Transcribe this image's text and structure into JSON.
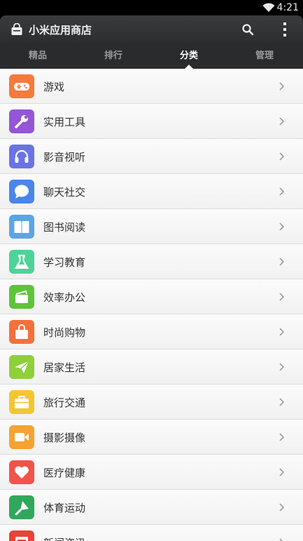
{
  "status_bar": {
    "time": "4:21",
    "wifi_icon": "wifi-icon"
  },
  "app_bar": {
    "title": "小米应用商店",
    "logo_icon": "shopping-bag-icon",
    "search_icon": "search-icon",
    "menu_icon": "more-vertical-icon"
  },
  "tabs": [
    {
      "label": "精品",
      "active": false
    },
    {
      "label": "排行",
      "active": false
    },
    {
      "label": "分类",
      "active": true
    },
    {
      "label": "管理",
      "active": false
    }
  ],
  "categories": [
    {
      "label": "游戏",
      "icon": "gamepad-icon",
      "color": "#f57a3c"
    },
    {
      "label": "实用工具",
      "icon": "wrench-icon",
      "color": "#9456d6"
    },
    {
      "label": "影音视听",
      "icon": "headphones-icon",
      "color": "#6a73e6"
    },
    {
      "label": "聊天社交",
      "icon": "chat-bubble-icon",
      "color": "#4a86e8"
    },
    {
      "label": "图书阅读",
      "icon": "book-icon",
      "color": "#5aa5e6"
    },
    {
      "label": "学习教育",
      "icon": "flask-icon",
      "color": "#4dd39a"
    },
    {
      "label": "效率办公",
      "icon": "briefcase-icon",
      "color": "#5cc43a"
    },
    {
      "label": "时尚购物",
      "icon": "shopping-bag-icon",
      "color": "#f5703a"
    },
    {
      "label": "居家生活",
      "icon": "paper-plane-icon",
      "color": "#8fcf3a"
    },
    {
      "label": "旅行交通",
      "icon": "suitcase-icon",
      "color": "#f5c531"
    },
    {
      "label": "摄影摄像",
      "icon": "video-camera-icon",
      "color": "#f7a232"
    },
    {
      "label": "医疗健康",
      "icon": "heart-icon",
      "color": "#f2534a"
    },
    {
      "label": "体育运动",
      "icon": "badminton-icon",
      "color": "#2fa85c"
    },
    {
      "label": "新闻资讯",
      "icon": "newspaper-icon",
      "color": "#e84336"
    }
  ]
}
